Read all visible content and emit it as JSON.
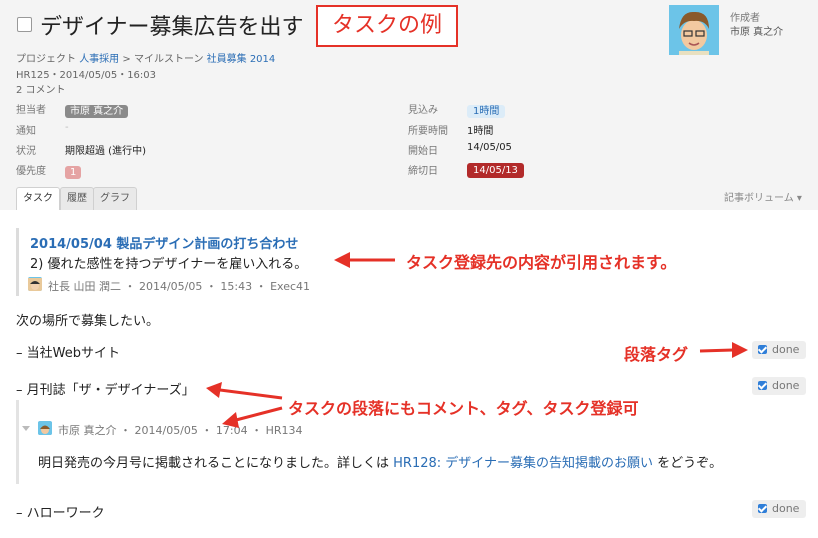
{
  "task": {
    "title": "デザイナー募集広告を出す",
    "callout_label": "タスクの例",
    "creator_label": "作成者",
    "creator_name": "市原 真之介",
    "breadcrumb": {
      "project_prefix": "プロジェクト",
      "project": "人事採用",
      "separator": ">",
      "milestone_prefix": "マイルストーン",
      "milestone": "社員募集 2014"
    },
    "id_date": "HR125・2014/05/05・16:03",
    "comments": "2 コメント"
  },
  "fields": {
    "assignee_label": "担当者",
    "assignee": "市原 真之介",
    "notify_label": "通知",
    "notify": "-",
    "status_label": "状況",
    "status": "期限超過 (進行中)",
    "priority_label": "優先度",
    "priority": "1",
    "estimate_label": "見込み",
    "estimate": "1時間",
    "actual_label": "所要時間",
    "actual": "1時間",
    "start_label": "開始日",
    "start": "14/05/05",
    "due_label": "締切日",
    "due": "14/05/13"
  },
  "tabs": [
    "タスク",
    "履歴",
    "グラフ"
  ],
  "volume_label": "記事ボリューム ▾",
  "quote": {
    "title": "2014/05/04 製品デザイン計画の打ち合わせ",
    "body": "2) 優れた感性を持つデザイナーを雇い入れる。",
    "meta": "社長 山田 潤二 ・ 2014/05/05 ・ 15:43 ・ Exec41"
  },
  "body": {
    "intro": "次の場所で募集したい。",
    "item1": "– 当社Webサイト",
    "item2": "– 月刊誌「ザ・デザイナーズ」",
    "item3": "– ハローワーク"
  },
  "comment": {
    "meta": "市原 真之介 ・ 2014/05/05 ・ 17:04 ・ HR134",
    "text_before": "明日発売の今月号に掲載されることになりました。詳しくは",
    "link": "HR128: デザイナー募集の告知掲載のお願い",
    "text_after": "をどうぞ。"
  },
  "done_label": "done",
  "callouts": {
    "quote": "タスク登録先の内容が引用されます。",
    "tag": "段落タグ",
    "paragraph": "タスクの段落にもコメント、タグ、タスク登録可"
  },
  "colors": {
    "accent": "#2a6db5",
    "callout": "#e53127",
    "due_badge": "#b22a2a"
  }
}
